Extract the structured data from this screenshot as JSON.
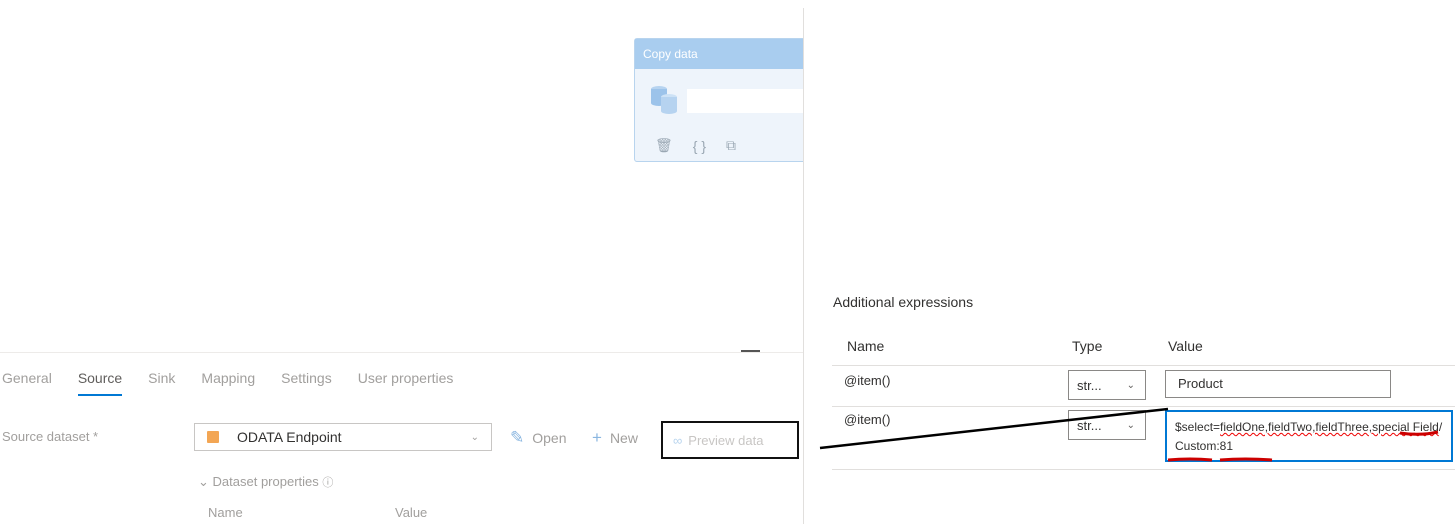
{
  "canvas": {
    "activity_title": "Copy data",
    "actions": [
      "delete-icon",
      "code-icon",
      "copy-icon"
    ]
  },
  "tabs": [
    {
      "label": "General"
    },
    {
      "label": "Source"
    },
    {
      "label": "Sink"
    },
    {
      "label": "Mapping"
    },
    {
      "label": "Settings"
    },
    {
      "label": "User properties"
    }
  ],
  "source": {
    "dataset_label": "Source dataset *",
    "dataset_value": "ODATA Endpoint",
    "open_label": "Open",
    "new_label": "New",
    "preview_label": "Preview data",
    "dataset_properties_label": "Dataset properties",
    "col_name": "Name",
    "col_value": "Value"
  },
  "panel": {
    "section_title": "Additional expressions",
    "headers": {
      "name": "Name",
      "type": "Type",
      "value": "Value"
    },
    "rows": [
      {
        "name": "@item()",
        "type": "str...",
        "value": "Product"
      },
      {
        "name": "@item()",
        "type": "str...",
        "value_prefix": "$select=",
        "value_fields": "fieldOne,fieldTwo,fieldThree,special Field",
        "value_suffix": "/Custom:81"
      }
    ]
  },
  "colors": {
    "accent": "#0078d4",
    "annotation": "#cc0000"
  }
}
